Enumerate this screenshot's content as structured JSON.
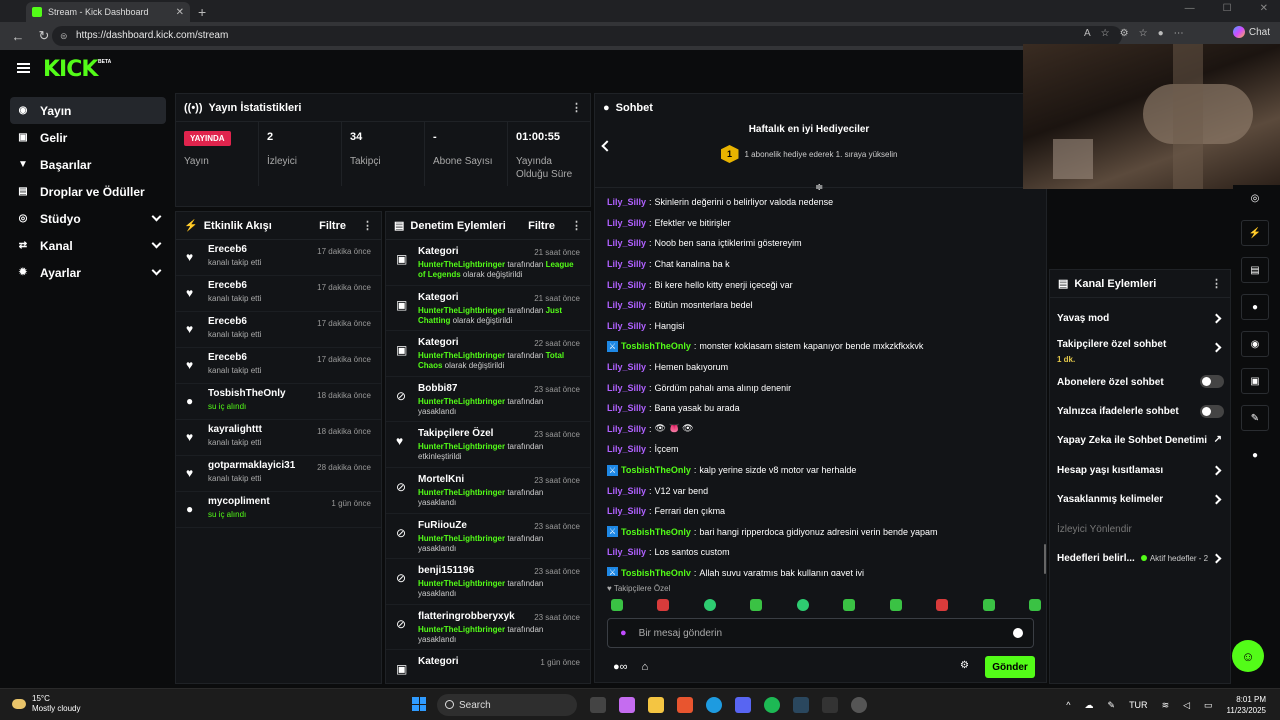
{
  "browser": {
    "tab_title": "Stream - Kick Dashboard",
    "url": "https://dashboard.kick.com/stream",
    "chat_label": "Chat"
  },
  "brand": {
    "logo": "KICK",
    "beta": "BETA",
    "accent": "#53fc18"
  },
  "sidebar": {
    "items": [
      {
        "label": "Yayın",
        "icon": "broadcast-icon"
      },
      {
        "label": "Gelir",
        "icon": "money-icon"
      },
      {
        "label": "Başarılar",
        "icon": "trophy-icon"
      },
      {
        "label": "Droplar ve Ödüller",
        "icon": "gift-icon"
      },
      {
        "label": "Stüdyo",
        "icon": "studio-icon"
      },
      {
        "label": "Kanal",
        "icon": "channel-icon"
      },
      {
        "label": "Ayarlar",
        "icon": "settings-icon"
      }
    ]
  },
  "stats": {
    "title": "Yayın İstatistikleri",
    "live_badge": "YAYINDA",
    "items": [
      {
        "value": "",
        "label": "Yayın"
      },
      {
        "value": "2",
        "label": "İzleyici"
      },
      {
        "value": "34",
        "label": "Takipçi"
      },
      {
        "value": "-",
        "label": "Abone Sayısı"
      },
      {
        "value": "01:00:55",
        "label": "Yayında Olduğu Süre"
      }
    ]
  },
  "activity": {
    "title": "Etkinlik Akışı",
    "filter": "Filtre",
    "events": [
      {
        "name": "Ereceb6",
        "sub": "kanalı takip etti",
        "time": "17 dakika önce",
        "icon": "heart-icon",
        "green": false
      },
      {
        "name": "Ereceb6",
        "sub": "kanalı takip etti",
        "time": "17 dakika önce",
        "icon": "heart-icon",
        "green": false
      },
      {
        "name": "Ereceb6",
        "sub": "kanalı takip etti",
        "time": "17 dakika önce",
        "icon": "heart-icon",
        "green": false
      },
      {
        "name": "Ereceb6",
        "sub": "kanalı takip etti",
        "time": "17 dakika önce",
        "icon": "heart-icon",
        "green": false
      },
      {
        "name": "TosbishTheOnly",
        "sub": "su iç alındı",
        "time": "18 dakika önce",
        "icon": "kick-points-icon",
        "green": true
      },
      {
        "name": "kayralighttt",
        "sub": "kanalı takip etti",
        "time": "18 dakika önce",
        "icon": "heart-icon",
        "green": false
      },
      {
        "name": "gotparmaklayici31",
        "sub": "kanalı takip etti",
        "time": "28 dakika önce",
        "icon": "heart-icon",
        "green": false
      },
      {
        "name": "mycopliment",
        "sub": "su iç alındı",
        "time": "1 gün önce",
        "icon": "kick-points-icon",
        "green": true
      }
    ]
  },
  "moderation": {
    "title": "Denetim Eylemleri",
    "filter": "Filtre",
    "items": [
      {
        "title": "Kategori",
        "time": "21 saat önce",
        "mod": "HunterTheLightbringer",
        "mid": " tarafından ",
        "target": "League of Legends",
        "end": " olarak değiştirildi",
        "icon": "category-icon"
      },
      {
        "title": "Kategori",
        "time": "21 saat önce",
        "mod": "HunterTheLightbringer",
        "mid": " tarafından ",
        "target": "Just Chatting",
        "end": " olarak değiştirildi",
        "icon": "category-icon"
      },
      {
        "title": "Kategori",
        "time": "22 saat önce",
        "mod": "HunterTheLightbringer",
        "mid": " tarafından ",
        "target": "Total Chaos",
        "end": " olarak değiştirildi",
        "icon": "category-icon"
      },
      {
        "title": "Bobbi87",
        "time": "23 saat önce",
        "mod": "HunterTheLightbringer",
        "mid": " tarafından ",
        "target": "",
        "end": "yasaklandı",
        "icon": "ban-icon"
      },
      {
        "title": "Takipçilere Özel",
        "time": "23 saat önce",
        "mod": "HunterTheLightbringer",
        "mid": " tarafından ",
        "target": "",
        "end": "etkinleştirildi",
        "icon": "heart-icon"
      },
      {
        "title": "MortelKni",
        "time": "23 saat önce",
        "mod": "HunterTheLightbringer",
        "mid": " tarafından ",
        "target": "",
        "end": "yasaklandı",
        "icon": "ban-icon"
      },
      {
        "title": "FuRiiouZe",
        "time": "23 saat önce",
        "mod": "HunterTheLightbringer",
        "mid": " tarafından ",
        "target": "",
        "end": "yasaklandı",
        "icon": "ban-icon"
      },
      {
        "title": "benji151196",
        "time": "23 saat önce",
        "mod": "HunterTheLightbringer",
        "mid": " tarafından ",
        "target": "",
        "end": "yasaklandı",
        "icon": "ban-icon"
      },
      {
        "title": "flatteringrobberyxyk",
        "time": "23 saat önce",
        "mod": "HunterTheLightbringer",
        "mid": " tarafından ",
        "target": "",
        "end": "yasaklandı",
        "icon": "ban-icon"
      },
      {
        "title": "Kategori",
        "time": "1 gün önce",
        "mod": "",
        "mid": "",
        "target": "",
        "end": "",
        "icon": "category-icon"
      }
    ]
  },
  "chat": {
    "title": "Sohbet",
    "gifters_title": "Haftalık en iyi Hediyeciler",
    "gifters_sub": "1 abonelik hediye ederek 1. sıraya yükselin",
    "gifters_rank": "1",
    "messages": [
      {
        "user": "Lily_Silly",
        "text": "Skinlerin değerini o belirliyor valoda nedense",
        "color": "#b061ff",
        "badge": false
      },
      {
        "user": "Lily_Silly",
        "text": "Efektler ve bitirişler",
        "color": "#b061ff",
        "badge": false
      },
      {
        "user": "Lily_Silly",
        "text": "Noob ben sana içtiklerimi göstereyim",
        "color": "#b061ff",
        "badge": false
      },
      {
        "user": "Lily_Silly",
        "text": "Chat kanalına ba k",
        "color": "#b061ff",
        "badge": false
      },
      {
        "user": "Lily_Silly",
        "text": "Bi kere hello kitty enerji içeceği var",
        "color": "#b061ff",
        "badge": false
      },
      {
        "user": "Lily_Silly",
        "text": "Bütün mosnterlara bedel",
        "color": "#b061ff",
        "badge": false
      },
      {
        "user": "Lily_Silly",
        "text": "Hangisi",
        "color": "#b061ff",
        "badge": false
      },
      {
        "user": "TosbishTheOnly",
        "text": "monster koklasam sistem kapanıyor bende mxkzkfkxkvk",
        "color": "#53fc18",
        "badge": true
      },
      {
        "user": "Lily_Silly",
        "text": "Hemen bakıyorum",
        "color": "#b061ff",
        "badge": false
      },
      {
        "user": "Lily_Silly",
        "text": "Gördüm pahalı ama alınıp denenir",
        "color": "#b061ff",
        "badge": false
      },
      {
        "user": "Lily_Silly",
        "text": "Bana yasak bu arada",
        "color": "#b061ff",
        "badge": false
      },
      {
        "user": "Lily_Silly",
        "text": "👁 👅 👁",
        "color": "#b061ff",
        "badge": false
      },
      {
        "user": "Lily_Silly",
        "text": "İçcem",
        "color": "#b061ff",
        "badge": false
      },
      {
        "user": "TosbishTheOnly",
        "text": "kalp yerine sizde v8 motor var herhalde",
        "color": "#53fc18",
        "badge": true
      },
      {
        "user": "Lily_Silly",
        "text": "V12 var bend",
        "color": "#b061ff",
        "badge": false
      },
      {
        "user": "Lily_Silly",
        "text": "Ferrari den çıkma",
        "color": "#b061ff",
        "badge": false
      },
      {
        "user": "TosbishTheOnly",
        "text": "bari hangi ripperdoca gidiyonuz adresini verin bende yapam",
        "color": "#53fc18",
        "badge": true
      },
      {
        "user": "Lily_Silly",
        "text": "Los santos custom",
        "color": "#b061ff",
        "badge": false
      },
      {
        "user": "TosbishTheOnly",
        "text": "Allah suyu yaratmış bak kullanın gayet iyi",
        "color": "#53fc18",
        "badge": true
      }
    ],
    "follower_only": "Takipçilere Özel",
    "input_placeholder": "Bir mesaj gönderin",
    "send": "Gönder",
    "emote_count": 10
  },
  "channel_actions": {
    "title": "Kanal Eylemleri",
    "items": [
      {
        "label": "Yavaş mod",
        "type": "arrow",
        "sub": "",
        "extra": ""
      },
      {
        "label": "Takipçilere özel sohbet",
        "type": "arrow",
        "sub": "1 dk.",
        "extra": ""
      },
      {
        "label": "Abonelere özel sohbet",
        "type": "toggle",
        "sub": "",
        "extra": ""
      },
      {
        "label": "Yalnızca ifadelerle sohbet",
        "type": "toggle",
        "sub": "",
        "extra": ""
      },
      {
        "label": "Yapay Zeka ile Sohbet Denetimi",
        "type": "external",
        "sub": "",
        "extra": ""
      },
      {
        "label": "Hesap yaşı kısıtlaması",
        "type": "arrow",
        "sub": "",
        "extra": ""
      },
      {
        "label": "Yasaklanmış kelimeler",
        "type": "arrow",
        "sub": "",
        "extra": ""
      },
      {
        "label": "İzleyici Yönlendir",
        "type": "dim",
        "sub": "",
        "extra": ""
      },
      {
        "label": "Hedefleri belirl...",
        "type": "arrow",
        "sub": "",
        "extra": "Aktif hedefler - 2"
      }
    ]
  },
  "rail": [
    "target-icon",
    "bolt-icon",
    "document-icon",
    "chat-icon",
    "broadcast-icon",
    "inbox-icon",
    "wrench-icon",
    "kick-points-icon"
  ],
  "taskbar": {
    "temp": "15°C",
    "weather": "Mostly cloudy",
    "search": "Search",
    "lang": "TUR",
    "time": "8:01 PM",
    "date": "11/23/2025"
  }
}
